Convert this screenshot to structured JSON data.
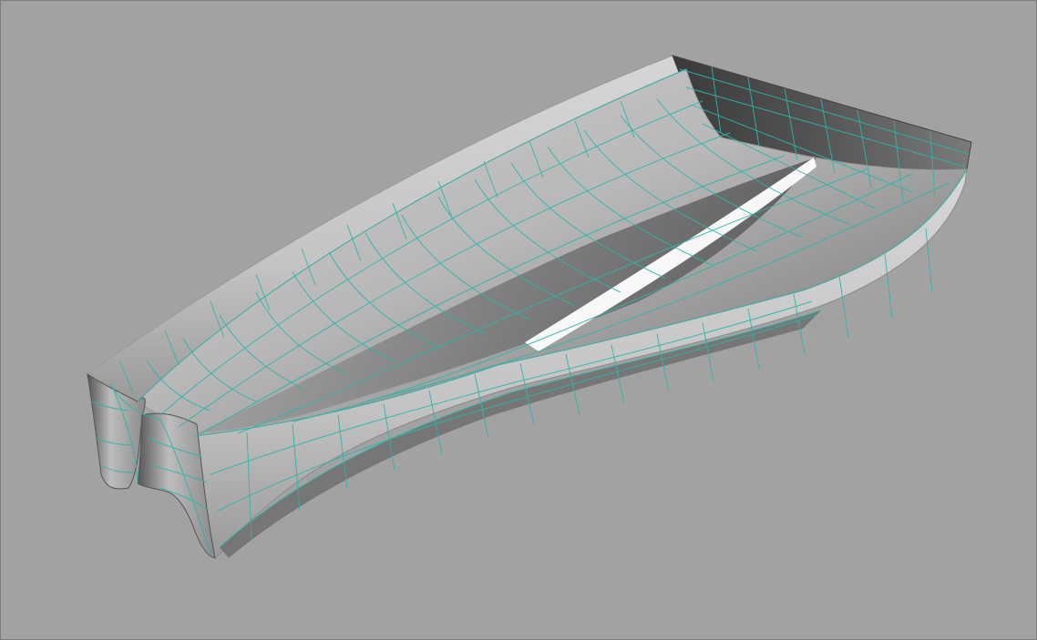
{
  "viewport": {
    "background_color": "#a2a2a2",
    "border_color": "#7c7c7c"
  },
  "model": {
    "type": "boat-hull-catamaran",
    "surface_shading": "grayscale",
    "wireframe_color": "#2fb4aa",
    "highlight_color": "#ffffff",
    "shadow_color": "#3c3c3c"
  }
}
